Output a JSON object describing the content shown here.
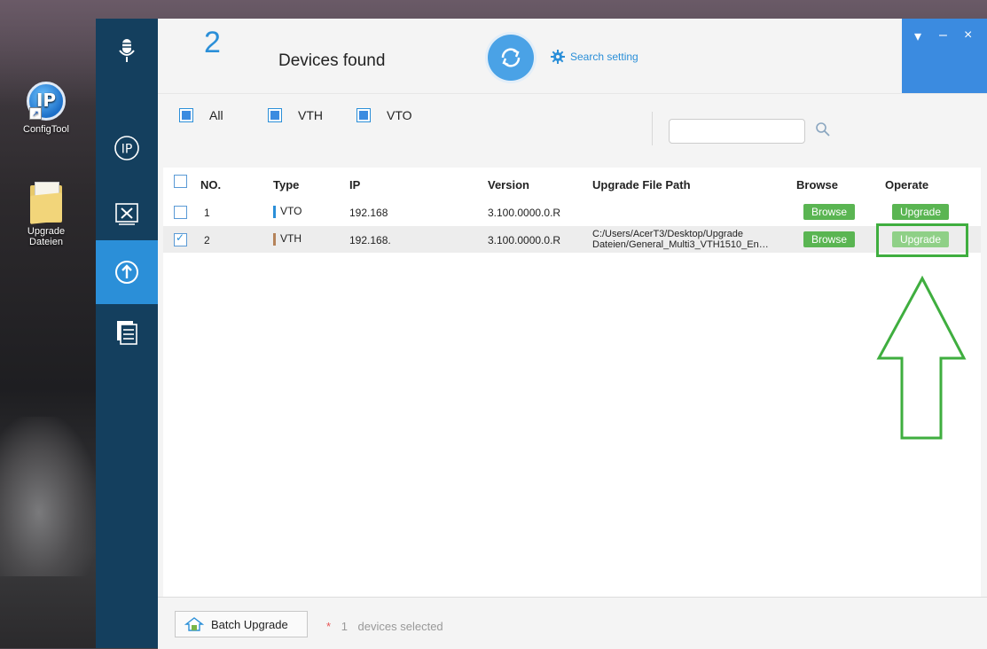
{
  "desktop": {
    "icons": [
      {
        "label": "ConfigTool",
        "logo_letter": "IP"
      },
      {
        "label": "Upgrade\nDateien"
      }
    ]
  },
  "sidebar": {
    "items": [
      {
        "name": "microphone"
      },
      {
        "name": "ip"
      },
      {
        "name": "tools"
      },
      {
        "name": "upgrade",
        "active": true
      },
      {
        "name": "list"
      }
    ]
  },
  "header": {
    "count": "2",
    "title": "Devices found",
    "search_setting": "Search setting"
  },
  "window_controls": {
    "menu": "▾",
    "minimize": "–",
    "close": "×"
  },
  "filters": {
    "all": "All",
    "vth": "VTH",
    "vto": "VTO",
    "search_placeholder": ""
  },
  "table": {
    "headers": {
      "no": "NO.",
      "type": "Type",
      "ip": "IP",
      "version": "Version",
      "path": "Upgrade File Path",
      "browse": "Browse",
      "operate": "Operate"
    },
    "rows": [
      {
        "checked": false,
        "no": "1",
        "type": "VTO",
        "type_color": "#2b8fd8",
        "ip": "192.168",
        "version": "3.100.0000.0.R",
        "path_line1": "",
        "path_line2": "",
        "browse": "Browse",
        "operate": "Upgrade"
      },
      {
        "checked": true,
        "no": "2",
        "type": "VTH",
        "type_color": "#b5835a",
        "ip": "192.168.",
        "version": "3.100.0000.0.R",
        "path_line1": "C:/Users/AcerT3/Desktop/Upgrade",
        "path_line2": "Dateien/General_Multi3_VTH1510_En…",
        "browse": "Browse",
        "operate": "Upgrade"
      }
    ]
  },
  "footer": {
    "batch_upgrade": "Batch Upgrade",
    "star": "*",
    "selected_count": "1",
    "selected_text": "devices selected"
  },
  "colors": {
    "accent": "#2b8fd8",
    "sidebar": "#143f5e",
    "button_green": "#5ab552",
    "annotation_green": "#3fae3f"
  }
}
